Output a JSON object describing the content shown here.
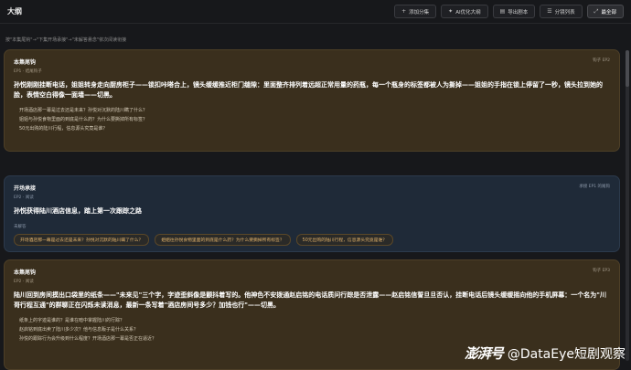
{
  "header": {
    "title": "大纲"
  },
  "toolbar": {
    "buttons": [
      {
        "icon": "+",
        "label": "添加分集"
      },
      {
        "icon": "✦",
        "label": "AI优化大纲"
      },
      {
        "icon": "▤",
        "label": "导出剧本"
      },
      {
        "icon": "☰",
        "label": "分镜列表"
      },
      {
        "icon": "⤢",
        "label": "最全部"
      }
    ]
  },
  "breadcrumb": "按\"本集尾钩\"→\"下集开场承接\"→\"未解答悬念\"依次阅读衔接",
  "cards": [
    {
      "title": "本集尾钩",
      "subtitle": "EP1 · 结尾钩子",
      "tag": "钩子 EP2",
      "main": "孙悦刚刚挂断电话，姐姐转身走向厨房柜子——锁扣咔嗒合上，镜头缓缓推近柜门缝隙：里面整齐排列着远超正常用量的药瓶，每一个瓶身的标签都被人为撕掉——姐姐的手指在锁上停留了一秒，镜头拉到她的脸，表情空白得像一面墙——切黑。",
      "questions": [
        "开场酒店那一幕是过去还是未来？孙悦对沉默的陆川瞒了什么？",
        "姐姐与孙悦食物里面的到底是什么药？为什么要撕掉所有标签？",
        "50元出购的陆川行程，信息源头究竟是谁？"
      ]
    },
    {
      "title": "开场承接",
      "subtitle": "EP2 · 阅读",
      "tag": "承接 EP1 的尾钩",
      "main": "孙悦获得陆川酒店信息，踏上第一次跟踪之路",
      "label": "未解答",
      "chips": [
        "开场酒店那一幕是过去还是未来？孙悦对沉默的陆川瞒了什么？",
        "姐姐往孙悦食物里面的到底是什么药？为什么要撕掉所有标签？",
        "50元出购的陆川行程，信息源头究竟是谁？"
      ]
    },
    {
      "title": "本集尾钩",
      "subtitle": "EP2 · 阅读",
      "tag": "钩子 EP3",
      "main": "陆川回到房间摸出口袋里的纸条——\"未来见\"三个字，字迹歪斜像是颤抖着写的。他神色不安拨通赵启铭的电话质问行踪是否泄露——赵启铭信誓旦旦否认，挂断电话后镜头缓缓摇向他的手机屏幕：一个名为\"川哥行程互通\"的群聊正在闪烁未读消息，最新一条写着\"酒店房间号多少？加钱也行\"——切黑。",
      "questions": [
        "纸条上的字迹是谁的？是谁在暗中掌握陆川的行踪？",
        "赵启铭到底出卖了陆川多少次？他与信息贩子是什么关系？",
        "孙悦的跟踪行为会升级到什么程度？开场酒店那一幕是否正在逼近？"
      ]
    }
  ],
  "watermark": {
    "logo": "澎湃号",
    "text": "@DataEye短剧观察"
  }
}
